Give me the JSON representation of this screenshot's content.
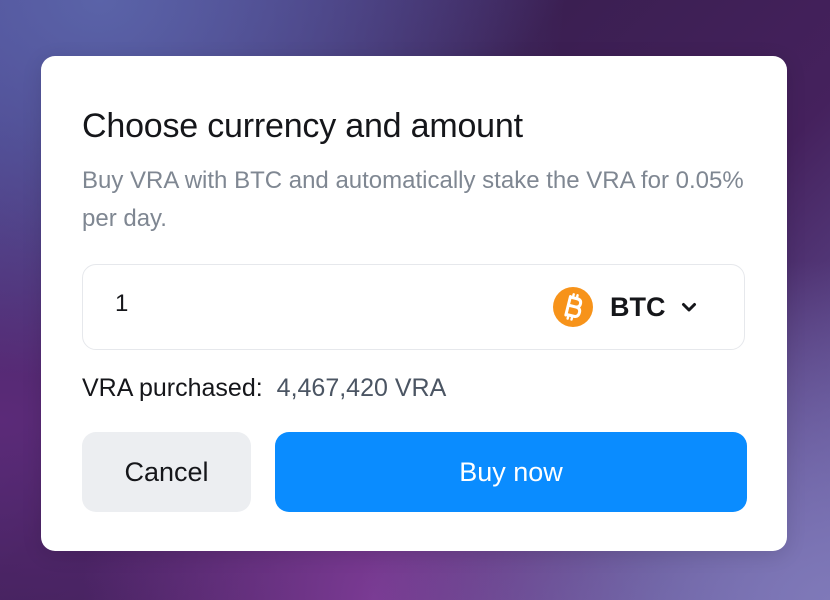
{
  "dialog": {
    "title": "Choose currency and amount",
    "subtitle": "Buy VRA with BTC and automatically stake the VRA for 0.05% per day.",
    "amount": {
      "value": "1",
      "currency": {
        "code": "BTC",
        "icon": "bitcoin-icon",
        "icon_color": "#f7931a"
      }
    },
    "purchased": {
      "label": "VRA purchased:",
      "value": "4,467,420 VRA"
    },
    "buttons": {
      "cancel": "Cancel",
      "buy": "Buy now",
      "buy_color": "#0a8cff"
    }
  }
}
